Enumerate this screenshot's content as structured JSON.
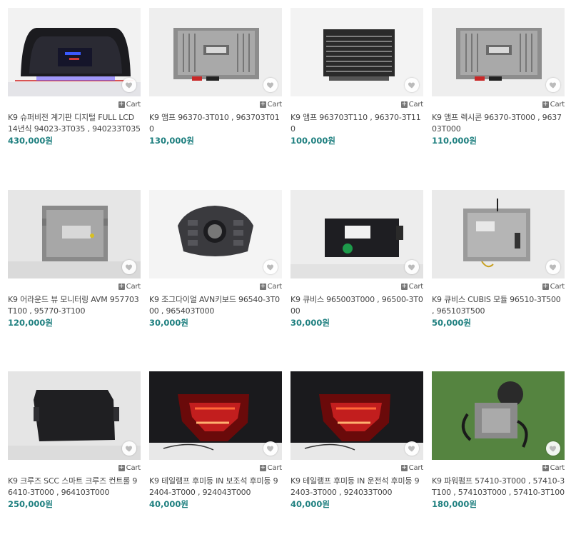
{
  "cart_label": "Cart",
  "colors": {
    "price": "#1e7f7f",
    "heart": "#bbbbbb"
  },
  "products": [
    {
      "title": "K9 슈퍼비전 계기판 디지털 FULL LCD 14년식 94023-3T035 , 940233T035",
      "price": "430,000원",
      "image": "instrument-cluster"
    },
    {
      "title": "K9 앰프 96370-3T010 , 963703T010",
      "price": "130,000원",
      "image": "lexicon-amp"
    },
    {
      "title": "K9 앰프 963703T110 , 96370-3T110",
      "price": "100,000원",
      "image": "amp-heatsink"
    },
    {
      "title": "K9 앰프 렉시콘 96370-3T000 , 963703T000",
      "price": "110,000원",
      "image": "lexicon-amp"
    },
    {
      "title": "K9 어라운드 뷰 모니터링 AVM 957703T100 , 95770-3T100",
      "price": "120,000원",
      "image": "avm-module"
    },
    {
      "title": "K9 조그다이얼 AVN키보드 96540-3T000 , 965403T000",
      "price": "30,000원",
      "image": "jog-dial"
    },
    {
      "title": "K9 큐비스 965003T000 , 96500-3T000",
      "price": "30,000원",
      "image": "cubis-module"
    },
    {
      "title": "K9 큐비스 CUBIS 모듈 96510-3T500 , 965103T500",
      "price": "50,000원",
      "image": "cubis-rack"
    },
    {
      "title": "K9 크루즈 SCC 스마트 크루즈 컨트롤 96410-3T000 , 964103T000",
      "price": "250,000원",
      "image": "scc-module"
    },
    {
      "title": "K9 테일램프 후미등 IN 보조석 후미등 92404-3T000 , 924043T000",
      "price": "40,000원",
      "image": "tail-lamp"
    },
    {
      "title": "K9 테일램프 후미등 IN 운전석 후미등 92403-3T000 , 924033T000",
      "price": "40,000원",
      "image": "tail-lamp"
    },
    {
      "title": "K9 파워펌프 57410-3T000 , 57410-3T100 , 574103T000 , 57410-3T100",
      "price": "180,000원",
      "image": "power-pump"
    }
  ]
}
